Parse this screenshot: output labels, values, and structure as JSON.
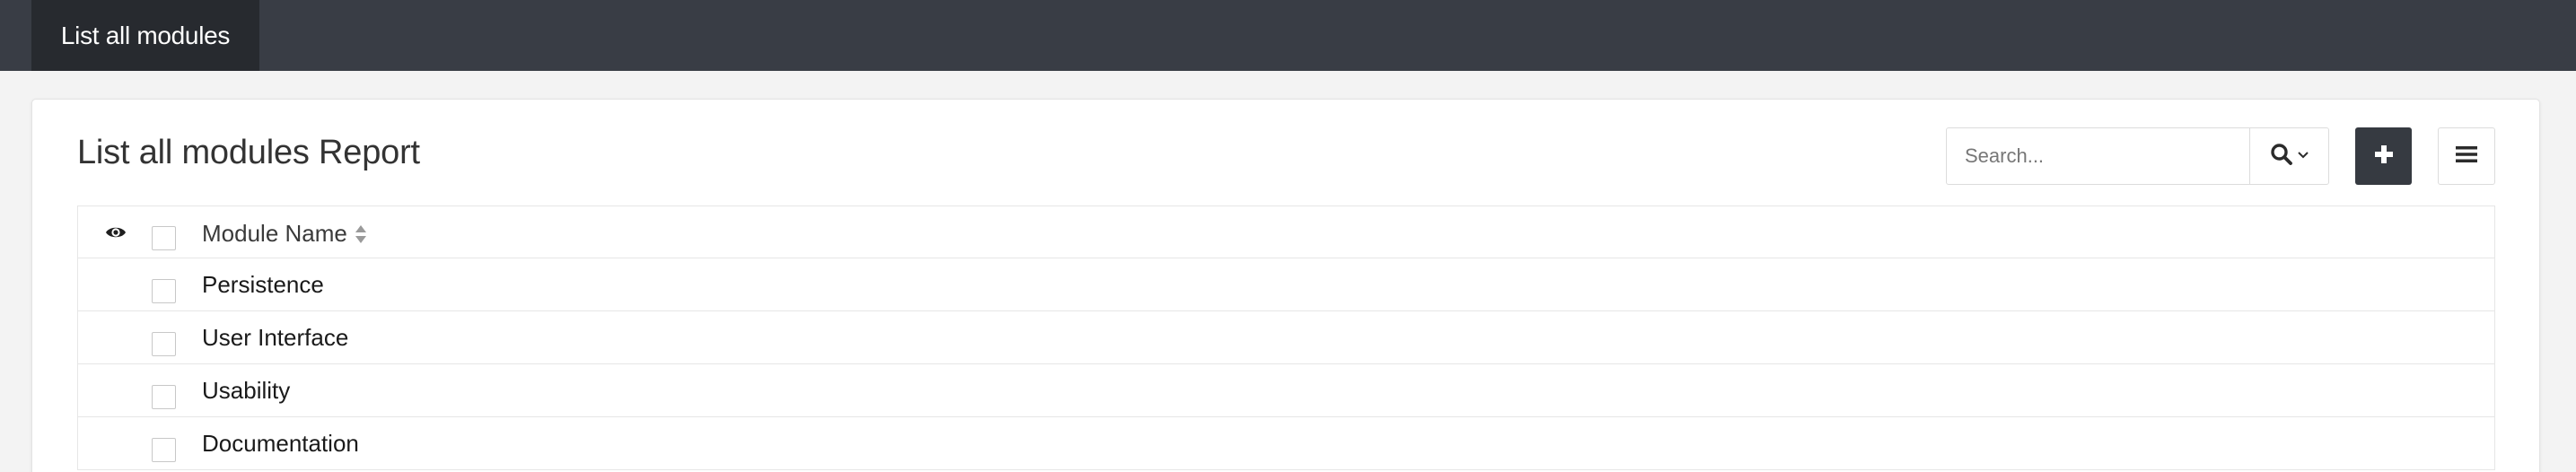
{
  "topbar": {
    "active_tab": "List all modules"
  },
  "report": {
    "title": "List all modules Report",
    "search": {
      "placeholder": "Search..."
    },
    "icons": {
      "search_button": "search-icon",
      "search_dropdown": "chevron-down-icon",
      "add_button": "plus-icon",
      "menu_button": "hamburger-menu-icon",
      "visibility": "eye-icon",
      "sort": "sort-icon"
    },
    "colors": {
      "topbar_bg": "#393d45",
      "active_tab_bg": "#272a2f",
      "primary_button_bg": "#363a41"
    }
  },
  "table": {
    "columns": [
      {
        "label": "Module Name"
      }
    ],
    "rows": [
      {
        "module_name": "Persistence"
      },
      {
        "module_name": "User Interface"
      },
      {
        "module_name": "Usability"
      },
      {
        "module_name": "Documentation"
      }
    ]
  }
}
